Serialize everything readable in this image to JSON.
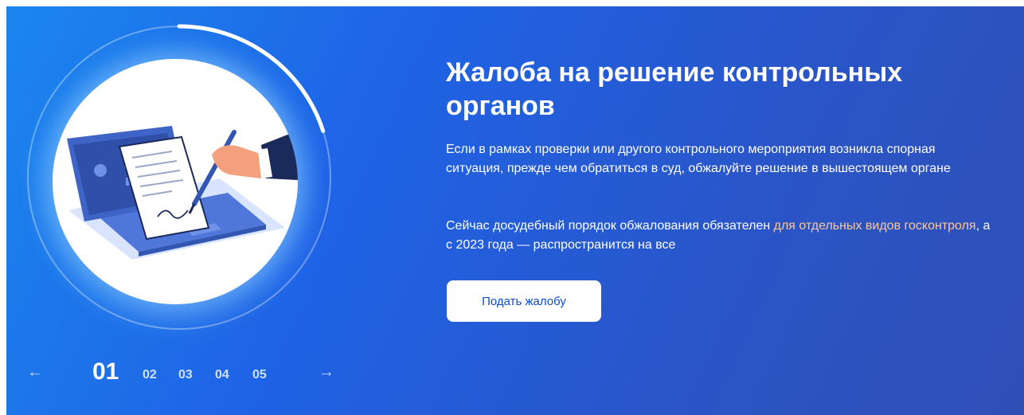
{
  "slide": {
    "title": "Жалоба на решение контрольных органов",
    "paragraph1": "Если в рамках проверки или другого контрольного мероприятия возникла спорная ситуация, прежде чем обратиться в суд, обжалуйте решение в вышестоящем органе",
    "paragraph2_before": "Сейчас досудебный порядок обжалования обязателен ",
    "paragraph2_link": "для отдельных видов госконтроля",
    "paragraph2_after": ", а с 2023 года — распространится на все",
    "button_label": "Подать жалобу",
    "link_color": "#ffc796",
    "progress_fraction": 0.2
  },
  "pager": {
    "prev_icon": "arrow-left-icon",
    "next_icon": "arrow-right-icon",
    "prev_glyph": "←",
    "next_glyph": "→",
    "items": [
      "01",
      "02",
      "03",
      "04",
      "05"
    ],
    "active": "01"
  },
  "colors": {
    "background_start": "#1b86ee",
    "background_end": "#2f4fb5",
    "button_text": "#0d4cd3"
  }
}
